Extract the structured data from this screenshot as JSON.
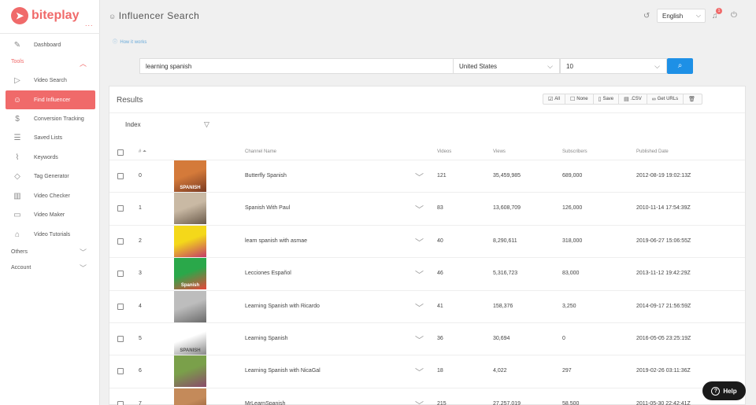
{
  "app": {
    "brand": "biteplay",
    "dots": "...",
    "title": "Influencer Search",
    "how_it_works": "How it works"
  },
  "sidebar": {
    "items": [
      {
        "label": "Dashboard",
        "icon": "pencil-icon"
      },
      {
        "label": "Video Search",
        "icon": "play-icon"
      },
      {
        "label": "Find Influencer",
        "icon": "influencer-icon"
      },
      {
        "label": "Conversion Tracking",
        "icon": "dollar-icon"
      },
      {
        "label": "Saved Lists",
        "icon": "list-icon"
      },
      {
        "label": "Keywords",
        "icon": "broadcast-icon"
      },
      {
        "label": "Tag Generator",
        "icon": "tag-icon"
      },
      {
        "label": "Video Checker",
        "icon": "chart-icon"
      },
      {
        "label": "Video Maker",
        "icon": "camera-icon"
      },
      {
        "label": "Video Tutorials",
        "icon": "graduation-icon"
      }
    ],
    "sections": {
      "tools": "Tools",
      "others": "Others",
      "account": "Account"
    }
  },
  "topbar": {
    "language": "English",
    "notifications": "1"
  },
  "search": {
    "query": "learning spanish",
    "country": "United States",
    "count": "10"
  },
  "results": {
    "title": "Results",
    "tools": [
      "All",
      "None",
      "Save",
      ".CSV",
      "Get URLs"
    ],
    "sort_field": "Index",
    "headers": {
      "num": "#",
      "channel": "Channel Name",
      "videos": "Videos",
      "views": "Views",
      "subscribers": "Subscribers",
      "published": "Published Date"
    },
    "rows": [
      {
        "idx": "0",
        "name": "Butterfly Spanish",
        "videos": "121",
        "views": "35,459,985",
        "subs": "689,000",
        "date": "2012-08-19 19:02:13Z",
        "thumb_text": "SPANISH",
        "colors": [
          "#d47a3a",
          "#7a3a22"
        ]
      },
      {
        "idx": "1",
        "name": "Spanish With Paul",
        "videos": "83",
        "views": "13,608,709",
        "subs": "126,000",
        "date": "2010-11-14 17:54:39Z",
        "thumb_text": "",
        "colors": [
          "#c9b9a4",
          "#6a5a4a"
        ]
      },
      {
        "idx": "2",
        "name": "learn spanish with asmae",
        "videos": "40",
        "views": "8,290,611",
        "subs": "318,000",
        "date": "2019-06-27 15:06:55Z",
        "thumb_text": "",
        "colors": [
          "#f4d81a",
          "#c33a6a"
        ]
      },
      {
        "idx": "3",
        "name": "Lecciones Español",
        "videos": "46",
        "views": "5,316,723",
        "subs": "83,000",
        "date": "2013-11-12 19:42:29Z",
        "thumb_text": "Spanish",
        "colors": [
          "#2aa84a",
          "#e8463a"
        ]
      },
      {
        "idx": "4",
        "name": "Learning Spanish with Ricardo",
        "videos": "41",
        "views": "158,376",
        "subs": "3,250",
        "date": "2014-09-17 21:56:59Z",
        "thumb_text": "",
        "colors": [
          "#bdbdbd",
          "#6a6a6a"
        ]
      },
      {
        "idx": "5",
        "name": "Learning Spanish",
        "videos": "36",
        "views": "30,694",
        "subs": "0",
        "date": "2016-05-05 23:25:19Z",
        "thumb_text": "SPANISH",
        "colors": [
          "#ffffff",
          "#888888"
        ]
      },
      {
        "idx": "6",
        "name": "Learning Spanish with NicaGal",
        "videos": "18",
        "views": "4,022",
        "subs": "297",
        "date": "2019-02-26 03:11:36Z",
        "thumb_text": "",
        "colors": [
          "#7aa04a",
          "#8a4a6a"
        ]
      },
      {
        "idx": "7",
        "name": "MrLearnSpanish",
        "videos": "215",
        "views": "27,257,019",
        "subs": "58,500",
        "date": "2011-05-30 22:42:41Z",
        "thumb_text": "",
        "colors": [
          "#c48a5a",
          "#7a4a2a"
        ]
      }
    ]
  },
  "help": {
    "label": "Help"
  },
  "colors": {
    "accent": "#f06a6a",
    "primary": "#1e90e6"
  }
}
